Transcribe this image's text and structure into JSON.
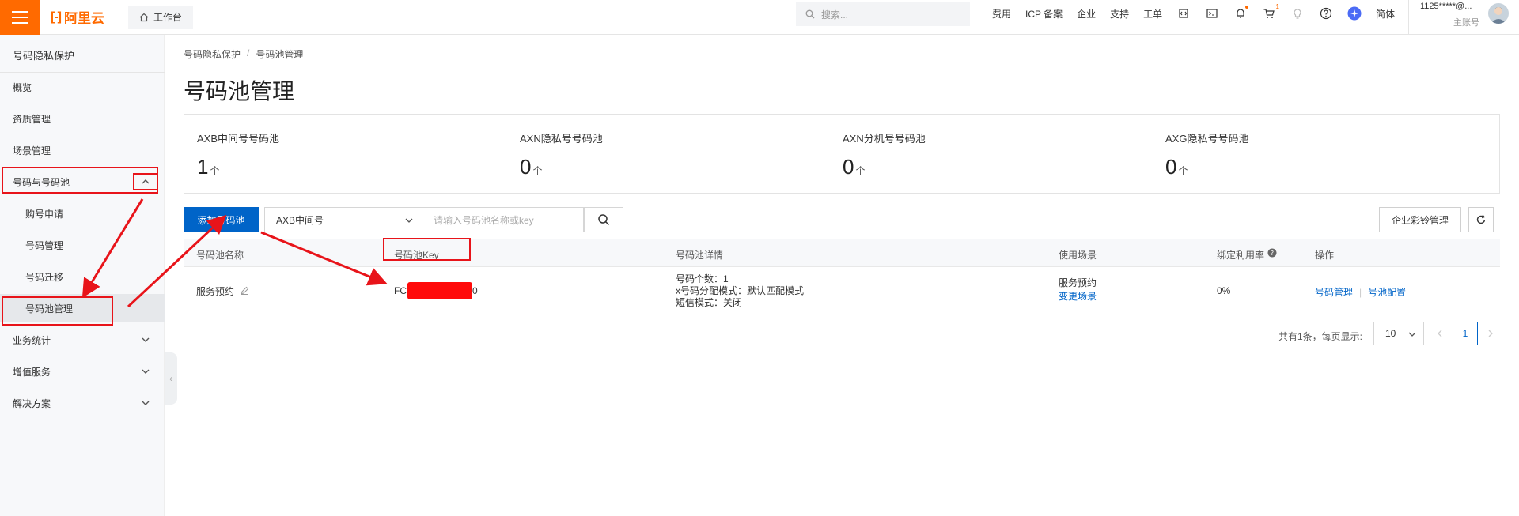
{
  "topbar": {
    "brand": "阿里云",
    "workbench": "工作台",
    "search_placeholder": "搜索...",
    "links": [
      "费用",
      "ICP 备案",
      "企业",
      "支持",
      "工单"
    ],
    "cart_badge": "1",
    "lang": "简体",
    "user_name": "1125*****@...",
    "user_role": "主账号"
  },
  "sidebar": {
    "title": "号码隐私保护",
    "items": [
      {
        "label": "概览"
      },
      {
        "label": "资质管理"
      },
      {
        "label": "场景管理"
      },
      {
        "label": "号码与号码池"
      },
      {
        "label": "购号申请"
      },
      {
        "label": "号码管理"
      },
      {
        "label": "号码迁移"
      },
      {
        "label": "号码池管理"
      },
      {
        "label": "业务统计"
      },
      {
        "label": "增值服务"
      },
      {
        "label": "解决方案"
      }
    ]
  },
  "breadcrumb": [
    "号码隐私保护",
    "/",
    "号码池管理"
  ],
  "page_title": "号码池管理",
  "stats": [
    {
      "label": "AXB中间号号码池",
      "value": "1",
      "unit": "个"
    },
    {
      "label": "AXN隐私号号码池",
      "value": "0",
      "unit": "个"
    },
    {
      "label": "AXN分机号号码池",
      "value": "0",
      "unit": "个"
    },
    {
      "label": "AXG隐私号号码池",
      "value": "0",
      "unit": "个"
    }
  ],
  "toolbar": {
    "add_label": "添加号码池",
    "type_select": "AXB中间号",
    "search_placeholder": "请输入号码池名称或key",
    "ringtone_label": "企业彩铃管理"
  },
  "table": {
    "columns": [
      "号码池名称",
      "号码池Key",
      "号码池详情",
      "使用场景",
      "绑定利用率",
      "操作"
    ],
    "rows": [
      {
        "name": "服务预约",
        "key_prefix": "FC",
        "key_suffix": "0",
        "details": [
          "号码个数：1",
          "x号码分配模式：默认匹配模式",
          "短信模式：关闭"
        ],
        "scene": "服务预约",
        "scene_link": "变更场景",
        "utilization": "0%",
        "action_manage": "号码管理",
        "action_config": "号池配置"
      }
    ]
  },
  "pagination": {
    "summary": "共有1条，每页显示:",
    "page_size": "10",
    "current": "1"
  },
  "colors": {
    "brand": "#ff6a00",
    "primary": "#0064c8",
    "annotation": "#e8141a"
  }
}
